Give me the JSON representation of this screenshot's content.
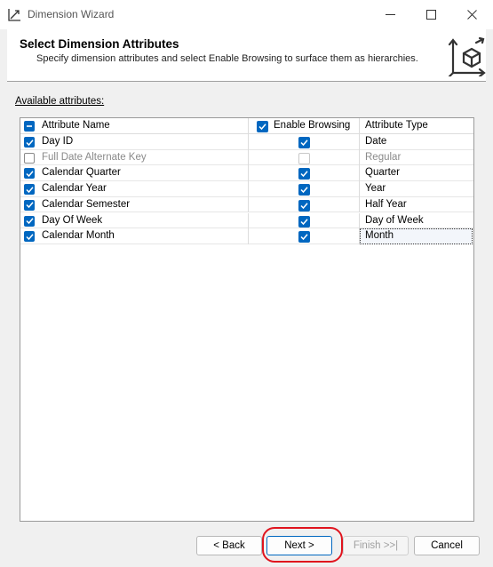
{
  "window": {
    "title": "Dimension Wizard"
  },
  "header": {
    "title": "Select Dimension Attributes",
    "subtitle": "Specify dimension attributes and select Enable Browsing to surface them as hierarchies."
  },
  "content": {
    "available_label": "Available attributes:"
  },
  "grid": {
    "columns": {
      "name": "Attribute Name",
      "browsing": "Enable Browsing",
      "type": "Attribute Type"
    },
    "rows": [
      {
        "name": "Day ID",
        "checked": true,
        "browsing": true,
        "type": "Date",
        "disabled": false
      },
      {
        "name": "Full Date Alternate Key",
        "checked": false,
        "browsing": false,
        "type": "Regular",
        "disabled": true
      },
      {
        "name": "Calendar Quarter",
        "checked": true,
        "browsing": true,
        "type": "Quarter",
        "disabled": false
      },
      {
        "name": "Calendar Year",
        "checked": true,
        "browsing": true,
        "type": "Year",
        "disabled": false
      },
      {
        "name": "Calendar Semester",
        "checked": true,
        "browsing": true,
        "type": "Half Year",
        "disabled": false
      },
      {
        "name": "Day Of Week",
        "checked": true,
        "browsing": true,
        "type": "Day of Week",
        "disabled": false
      },
      {
        "name": "Calendar Month",
        "checked": true,
        "browsing": true,
        "type": "Month",
        "disabled": false
      }
    ]
  },
  "buttons": {
    "back": "< Back",
    "next": "Next >",
    "finish": "Finish >>|",
    "cancel": "Cancel"
  },
  "colors": {
    "accent": "#0067c0",
    "annotation": "#e0141e"
  }
}
